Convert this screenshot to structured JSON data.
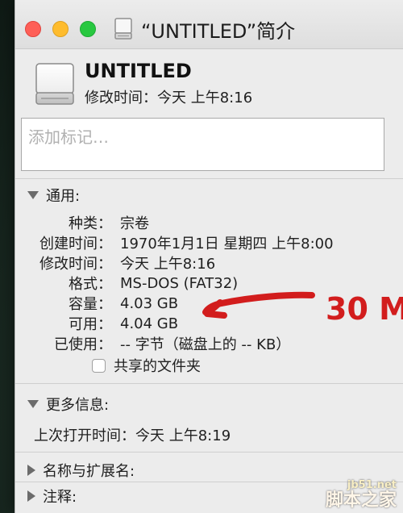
{
  "window": {
    "title": "“UNTITLED”简介"
  },
  "summary": {
    "name": "UNTITLED",
    "modified": "修改时间：今天 上午8:16"
  },
  "comments": {
    "placeholder": "添加标记…"
  },
  "general": {
    "header": "通用:",
    "rows": [
      {
        "label": "种类：",
        "value": "宗卷"
      },
      {
        "label": "创建时间：",
        "value": "1970年1月1日 星期四 上午8:00"
      },
      {
        "label": "修改时间：",
        "value": "今天 上午8:16"
      },
      {
        "label": "格式：",
        "value": "MS-DOS (FAT32)"
      },
      {
        "label": "容量：",
        "value": "4.03 GB"
      },
      {
        "label": "可用：",
        "value": "4.04 GB"
      },
      {
        "label": "已使用：",
        "value": "-- 字节（磁盘上的 -- KB）"
      }
    ],
    "shared_folder_label": "共享的文件夹"
  },
  "more_info": {
    "header": "更多信息:",
    "last_opened": "上次打开时间：今天 上午8:19"
  },
  "name_extension": {
    "header": "名称与扩展名:"
  },
  "notes": {
    "header": "注释:"
  },
  "annotation": {
    "text": "30 M",
    "color": "#d21d1d"
  },
  "watermark": {
    "line1": "jb51.net",
    "line2": "脚本之家"
  },
  "icons": {
    "close": "close-icon",
    "minimize": "minimize-icon",
    "zoom": "zoom-icon",
    "drive": "drive-icon",
    "disclosure": "disclosure-triangle-icon",
    "checkbox": "checkbox-icon",
    "arrow": "arrow-icon"
  }
}
